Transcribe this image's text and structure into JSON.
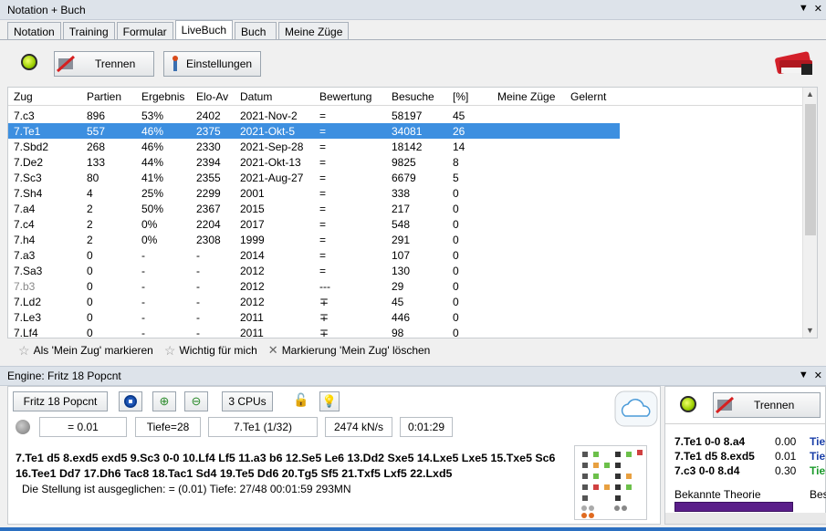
{
  "top_panel": {
    "title": "Notation + Buch"
  },
  "tabs": [
    "Notation",
    "Training",
    "Formular",
    "LiveBuch",
    "Buch",
    "Meine Züge"
  ],
  "toolbar": {
    "disconnect_label": "Trennen",
    "settings_label": "Einstellungen"
  },
  "table": {
    "headers": [
      "Zug",
      "Partien",
      "Ergebnis",
      "Elo-Av",
      "Datum",
      "Bewertung",
      "Besuche",
      "[%]",
      "Meine Züge",
      "Gelernt"
    ],
    "rows": [
      [
        "7.c3",
        "896",
        "53%",
        "2402",
        "2021-Nov-2",
        "=",
        "58197",
        "45"
      ],
      [
        "7.Te1",
        "557",
        "46%",
        "2375",
        "2021-Okt-5",
        "=",
        "34081",
        "26"
      ],
      [
        "7.Sbd2",
        "268",
        "46%",
        "2330",
        "2021-Sep-28",
        "=",
        "18142",
        "14"
      ],
      [
        "7.De2",
        "133",
        "44%",
        "2394",
        "2021-Okt-13",
        "=",
        "9825",
        "8"
      ],
      [
        "7.Sc3",
        "80",
        "41%",
        "2355",
        "2021-Aug-27",
        "=",
        "6679",
        "5"
      ],
      [
        "7.Sh4",
        "4",
        "25%",
        "2299",
        "2001",
        "=",
        "338",
        "0"
      ],
      [
        "7.a4",
        "2",
        "50%",
        "2367",
        "2015",
        "=",
        "217",
        "0"
      ],
      [
        "7.c4",
        "2",
        "0%",
        "2204",
        "2017",
        "=",
        "548",
        "0"
      ],
      [
        "7.h4",
        "2",
        "0%",
        "2308",
        "1999",
        "=",
        "291",
        "0"
      ],
      [
        "7.a3",
        "0",
        "-",
        "-",
        "2014",
        "=",
        "107",
        "0"
      ],
      [
        "7.Sa3",
        "0",
        "-",
        "-",
        "2012",
        "=",
        "130",
        "0"
      ],
      [
        "7.b3",
        "0",
        "-",
        "-",
        "2012",
        "---",
        "29",
        "0"
      ],
      [
        "7.Ld2",
        "0",
        "-",
        "-",
        "2012",
        "∓",
        "45",
        "0"
      ],
      [
        "7.Le3",
        "0",
        "-",
        "-",
        "2011",
        "∓",
        "446",
        "0"
      ],
      [
        "7.Lf4",
        "0",
        "-",
        "-",
        "2011",
        "∓",
        "98",
        "0"
      ]
    ],
    "selected_row": 1
  },
  "marker_bar": {
    "mark_label": "Als 'Mein Zug' markieren",
    "important_label": "Wichtig für mich",
    "delete_label": "Markierung 'Mein Zug' löschen"
  },
  "engine": {
    "title": "Engine: Fritz 18 Popcnt",
    "name": "Fritz 18 Popcnt",
    "cpus": "3 CPUs",
    "eval": "= 0.01",
    "depth": "Tiefe=28",
    "move": "7.Te1 (1/32)",
    "speed": "2474 kN/s",
    "time": "0:01:29",
    "pv": "7.Te1 d5 8.exd5 exd5 9.Sc3 0-0 10.Lf4 Lf5 11.a3 b6 12.Se5 Le6 13.Dd2 Sxe5 14.Lxe5 Lxe5 15.Txe5 Sc6 16.Tee1 Dd7 17.Dh6 Tac8 18.Tac1 Sd4 19.Te5 Dd6 20.Tg5 Sf5 21.Txf5 Lxf5 22.Lxd5",
    "info": "Die Stellung ist ausgeglichen: = (0.01)  Tiefe: 27/48   00:01:59  293MN"
  },
  "right_panel": {
    "disconnect_label": "Trennen",
    "lines": [
      {
        "move": "7.Te1 0-0 8.a4",
        "score": "0.00",
        "tag": "Tie"
      },
      {
        "move": "7.Te1 d5 8.exd5",
        "score": "0.01",
        "tag": "Tie"
      },
      {
        "move": "7.c3 0-0 8.d4",
        "score": "0.30",
        "tag": "Tie"
      }
    ],
    "theory_label": "Bekannte Theorie",
    "theory_right": "Bes"
  }
}
